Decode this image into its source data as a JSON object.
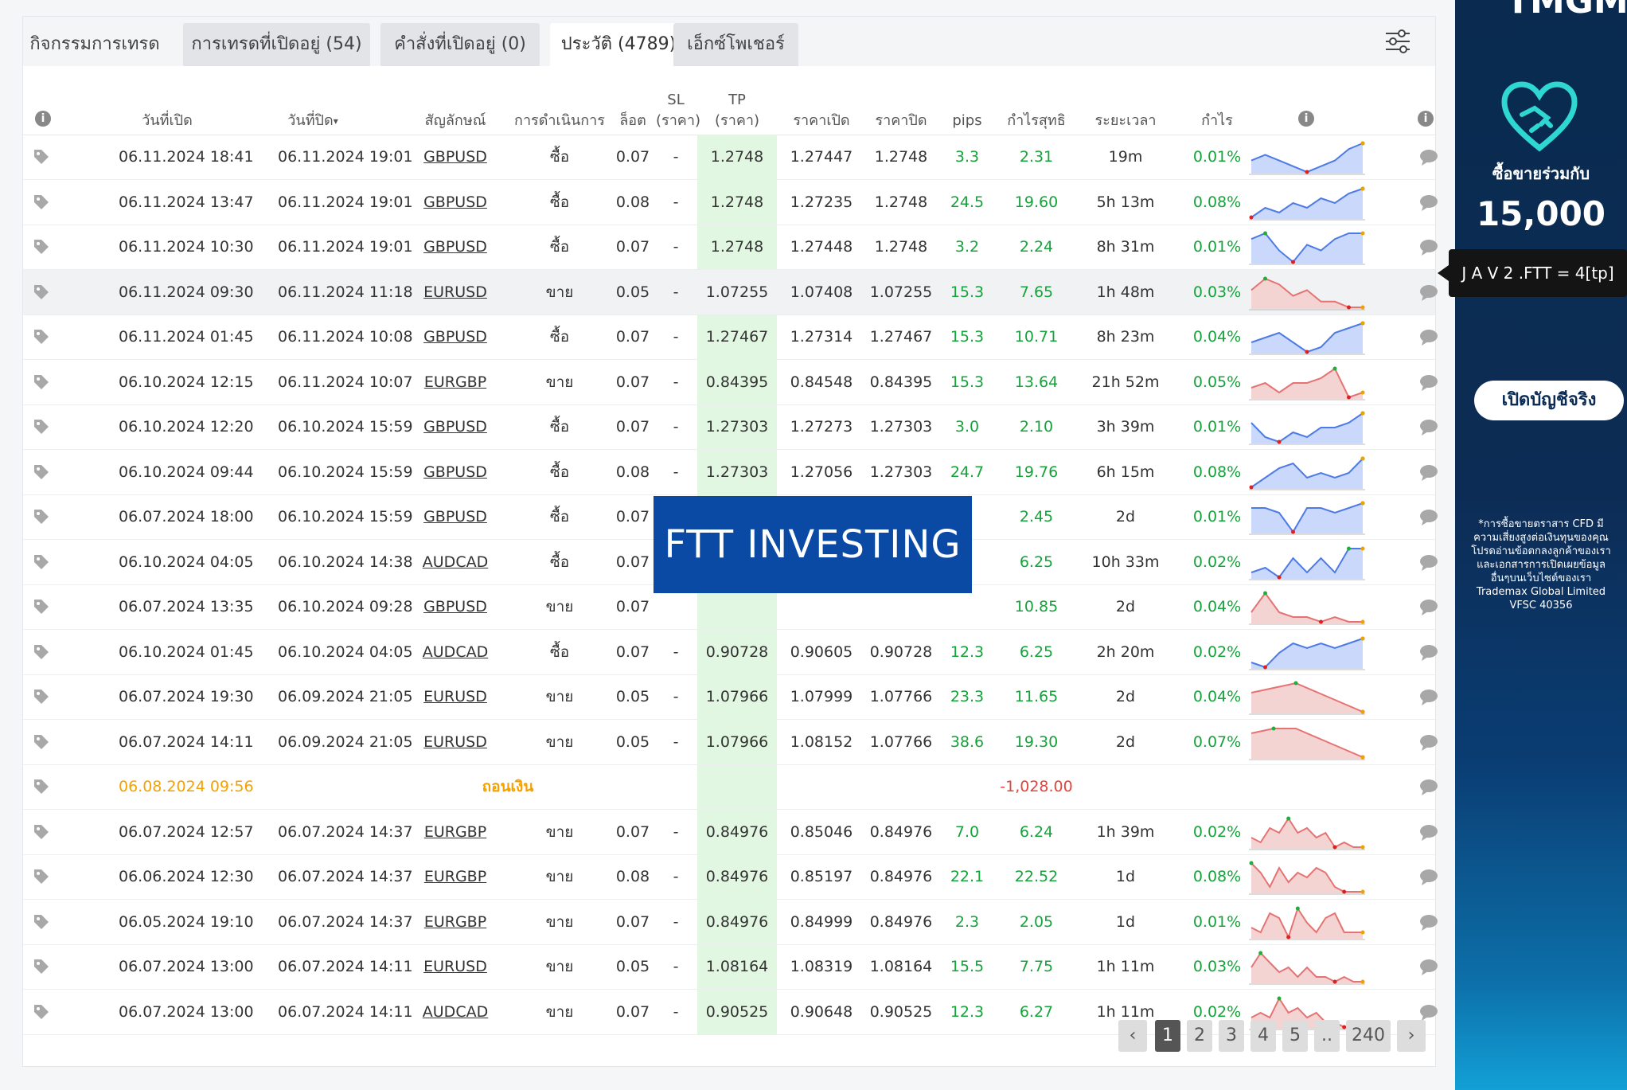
{
  "tabs": [
    {
      "label": "กิจกรรมการเทรด"
    },
    {
      "label": "การเทรดที่เปิดอยู่ (54)"
    },
    {
      "label": "คำสั่งที่เปิดอยู่ (0)"
    },
    {
      "label": "ประวัติ (4789)"
    },
    {
      "label": "เอ็กซ์โพเชอร์"
    }
  ],
  "active_tab": 3,
  "headers": {
    "open_time": "วันที่เปิด",
    "close_time": "วันที่ปิด",
    "sort_arrow": "▾",
    "symbol": "สัญลักษณ์",
    "action": "การดำเนินการ",
    "lots": "ล็อต",
    "sl_line1": "SL",
    "sl_line2": "(ราคา)",
    "tp_line1": "TP",
    "tp_line2": "(ราคา)",
    "open_price": "ราคาเปิด",
    "close_price": "ราคาปิด",
    "pips": "pips",
    "net_profit": "กำไรสุทธิ",
    "duration": "ระยะเวลา",
    "gain": "กำไร"
  },
  "rows": [
    {
      "open": "06.11.2024 18:41",
      "close": "06.11.2024 19:01",
      "symbol": "GBPUSD",
      "action": "ซื้อ",
      "lots": "0.07",
      "sl": "-",
      "tp": "1.2748",
      "open_price": "1.27447",
      "close_price": "1.2748",
      "pips": "3.3",
      "profit": "2.31",
      "duration": "19m",
      "gain": "0.01%",
      "spark": "buy",
      "spark_values": [
        3,
        4,
        3,
        2,
        1,
        2,
        3,
        5,
        6
      ]
    },
    {
      "open": "06.11.2024 13:47",
      "close": "06.11.2024 19:01",
      "symbol": "GBPUSD",
      "action": "ซื้อ",
      "lots": "0.08",
      "sl": "-",
      "tp": "1.2748",
      "open_price": "1.27235",
      "close_price": "1.2748",
      "pips": "24.5",
      "profit": "19.60",
      "duration": "5h 13m",
      "gain": "0.08%",
      "spark": "buy",
      "spark_values": [
        1,
        3,
        2,
        4,
        3,
        5,
        4,
        6,
        7
      ]
    },
    {
      "open": "06.11.2024 10:30",
      "close": "06.11.2024 19:01",
      "symbol": "GBPUSD",
      "action": "ซื้อ",
      "lots": "0.07",
      "sl": "-",
      "tp": "1.2748",
      "open_price": "1.27448",
      "close_price": "1.2748",
      "pips": "3.2",
      "profit": "2.24",
      "duration": "8h 31m",
      "gain": "0.01%",
      "spark": "buy",
      "spark_values": [
        5,
        6,
        3,
        1,
        4,
        3,
        5,
        6,
        6
      ]
    },
    {
      "open": "06.11.2024 09:30",
      "close": "06.11.2024 11:18",
      "symbol": "EURUSD",
      "action": "ขาย",
      "lots": "0.05",
      "sl": "-",
      "tp": "1.07255",
      "open_price": "1.07408",
      "close_price": "1.07255",
      "pips": "15.3",
      "profit": "7.65",
      "duration": "1h 48m",
      "gain": "0.03%",
      "spark": "sell",
      "spark_values": [
        4,
        6,
        5,
        3,
        4,
        2,
        2,
        1,
        1
      ],
      "highlight": true
    },
    {
      "open": "06.11.2024 01:45",
      "close": "06.11.2024 10:08",
      "symbol": "GBPUSD",
      "action": "ซื้อ",
      "lots": "0.07",
      "sl": "-",
      "tp": "1.27467",
      "open_price": "1.27314",
      "close_price": "1.27467",
      "pips": "15.3",
      "profit": "10.71",
      "duration": "8h 23m",
      "gain": "0.04%",
      "spark": "buy",
      "spark_values": [
        3,
        4,
        5,
        3,
        1,
        2,
        5,
        6,
        7
      ]
    },
    {
      "open": "06.10.2024 12:15",
      "close": "06.11.2024 10:07",
      "symbol": "EURGBP",
      "action": "ขาย",
      "lots": "0.07",
      "sl": "-",
      "tp": "0.84395",
      "open_price": "0.84548",
      "close_price": "0.84395",
      "pips": "15.3",
      "profit": "13.64",
      "duration": "21h 52m",
      "gain": "0.05%",
      "spark": "sell",
      "spark_values": [
        3,
        4,
        2,
        4,
        4,
        5,
        7,
        1,
        2
      ]
    },
    {
      "open": "06.10.2024 12:20",
      "close": "06.10.2024 15:59",
      "symbol": "GBPUSD",
      "action": "ซื้อ",
      "lots": "0.07",
      "sl": "-",
      "tp": "1.27303",
      "open_price": "1.27273",
      "close_price": "1.27303",
      "pips": "3.0",
      "profit": "2.10",
      "duration": "3h 39m",
      "gain": "0.01%",
      "spark": "buy",
      "spark_values": [
        5,
        2,
        1,
        3,
        2,
        4,
        4,
        5,
        7
      ]
    },
    {
      "open": "06.10.2024 09:44",
      "close": "06.10.2024 15:59",
      "symbol": "GBPUSD",
      "action": "ซื้อ",
      "lots": "0.08",
      "sl": "-",
      "tp": "1.27303",
      "open_price": "1.27056",
      "close_price": "1.27303",
      "pips": "24.7",
      "profit": "19.76",
      "duration": "6h 15m",
      "gain": "0.08%",
      "spark": "buy",
      "spark_values": [
        1,
        3,
        5,
        6,
        3,
        4,
        3,
        4,
        7
      ]
    },
    {
      "open": "06.07.2024 18:00",
      "close": "06.10.2024 15:59",
      "symbol": "GBPUSD",
      "action": "ซื้อ",
      "lots": "0.07",
      "sl": "",
      "tp": "",
      "open_price": "",
      "close_price": "",
      "pips": "",
      "profit": "2.45",
      "duration": "2d",
      "gain": "0.01%",
      "spark": "buy",
      "spark_values": [
        6,
        6,
        5,
        1,
        6,
        6,
        5,
        6,
        7
      ]
    },
    {
      "open": "06.10.2024 04:05",
      "close": "06.10.2024 14:38",
      "symbol": "AUDCAD",
      "action": "ซื้อ",
      "lots": "0.07",
      "sl": "",
      "tp": "",
      "open_price": "",
      "close_price": "",
      "pips": "",
      "profit": "6.25",
      "duration": "10h 33m",
      "gain": "0.02%",
      "spark": "buy",
      "spark_values": [
        2,
        3,
        1,
        5,
        2,
        5,
        2,
        7,
        7
      ]
    },
    {
      "open": "06.07.2024 13:35",
      "close": "06.10.2024 09:28",
      "symbol": "GBPUSD",
      "action": "ขาย",
      "lots": "0.07",
      "sl": "",
      "tp": "",
      "open_price": "",
      "close_price": "",
      "pips": "",
      "profit": "10.85",
      "duration": "2d",
      "gain": "0.04%",
      "spark": "sell",
      "spark_values": [
        3,
        7,
        3,
        2,
        2,
        1,
        2,
        1,
        1
      ]
    },
    {
      "open": "06.10.2024 01:45",
      "close": "06.10.2024 04:05",
      "symbol": "AUDCAD",
      "action": "ซื้อ",
      "lots": "0.07",
      "sl": "-",
      "tp": "0.90728",
      "open_price": "0.90605",
      "close_price": "0.90728",
      "pips": "12.3",
      "profit": "6.25",
      "duration": "2h 20m",
      "gain": "0.02%",
      "spark": "buy",
      "spark_values": [
        2,
        1,
        4,
        6,
        5,
        6,
        5,
        6,
        7
      ]
    },
    {
      "open": "06.07.2024 19:30",
      "close": "06.09.2024 21:05",
      "symbol": "EURUSD",
      "action": "ขาย",
      "lots": "0.05",
      "sl": "-",
      "tp": "1.07966",
      "open_price": "1.07999",
      "close_price": "1.07766",
      "pips": "23.3",
      "profit": "11.65",
      "duration": "2d",
      "gain": "0.04%",
      "spark": "sell",
      "spark_values": [
        6,
        7,
        8,
        6,
        4,
        2
      ]
    },
    {
      "open": "06.07.2024 14:11",
      "close": "06.09.2024 21:05",
      "symbol": "EURUSD",
      "action": "ขาย",
      "lots": "0.05",
      "sl": "-",
      "tp": "1.07966",
      "open_price": "1.08152",
      "close_price": "1.07766",
      "pips": "38.6",
      "profit": "19.30",
      "duration": "2d",
      "gain": "0.07%",
      "spark": "sell",
      "spark_values": [
        6,
        7,
        7,
        5,
        3,
        1
      ]
    },
    {
      "open": "06.08.2024 09:56",
      "close": "",
      "symbol": "",
      "action": "ถอนเงิน",
      "lots": "",
      "sl": "",
      "tp": "",
      "open_price": "",
      "close_price": "",
      "pips": "",
      "profit": "-1,028.00",
      "duration": "",
      "gain": "",
      "spark": "none",
      "withdrawal": true
    },
    {
      "open": "06.07.2024 12:57",
      "close": "06.07.2024 14:37",
      "symbol": "EURGBP",
      "action": "ขาย",
      "lots": "0.07",
      "sl": "-",
      "tp": "0.84976",
      "open_price": "0.85046",
      "close_price": "0.84976",
      "pips": "7.0",
      "profit": "6.24",
      "duration": "1h 39m",
      "gain": "0.02%",
      "spark": "sell",
      "spark_values": [
        3,
        2,
        5,
        4,
        7,
        4,
        5,
        3,
        4,
        1,
        2,
        1,
        1
      ]
    },
    {
      "open": "06.06.2024 12:30",
      "close": "06.07.2024 14:37",
      "symbol": "EURGBP",
      "action": "ขาย",
      "lots": "0.08",
      "sl": "-",
      "tp": "0.84976",
      "open_price": "0.85197",
      "close_price": "0.84976",
      "pips": "22.1",
      "profit": "22.52",
      "duration": "1d",
      "gain": "0.08%",
      "spark": "sell",
      "spark_values": [
        7,
        5,
        2,
        6,
        3,
        5,
        4,
        6,
        5,
        2,
        1,
        1,
        1
      ]
    },
    {
      "open": "06.05.2024 19:10",
      "close": "06.07.2024 14:37",
      "symbol": "EURGBP",
      "action": "ขาย",
      "lots": "0.07",
      "sl": "-",
      "tp": "0.84976",
      "open_price": "0.84999",
      "close_price": "0.84976",
      "pips": "2.3",
      "profit": "2.05",
      "duration": "1d",
      "gain": "0.01%",
      "spark": "sell",
      "spark_values": [
        3,
        2,
        6,
        5,
        1,
        7,
        4,
        2,
        5,
        6,
        2,
        2,
        2
      ]
    },
    {
      "open": "06.07.2024 13:00",
      "close": "06.07.2024 14:11",
      "symbol": "EURUSD",
      "action": "ขาย",
      "lots": "0.05",
      "sl": "-",
      "tp": "1.08164",
      "open_price": "1.08319",
      "close_price": "1.08164",
      "pips": "15.5",
      "profit": "7.75",
      "duration": "1h 11m",
      "gain": "0.03%",
      "spark": "sell",
      "spark_values": [
        4,
        7,
        5,
        3,
        4,
        2,
        4,
        2,
        2,
        1,
        2,
        1,
        1
      ]
    },
    {
      "open": "06.07.2024 13:00",
      "close": "06.07.2024 14:11",
      "symbol": "AUDCAD",
      "action": "ขาย",
      "lots": "0.07",
      "sl": "-",
      "tp": "0.90525",
      "open_price": "0.90648",
      "close_price": "0.90525",
      "pips": "12.3",
      "profit": "6.27",
      "duration": "1h 11m",
      "gain": "0.02%",
      "spark": "sell",
      "spark_values": [
        3,
        4,
        3,
        7,
        4,
        5,
        3,
        4,
        2,
        2,
        1,
        1,
        1
      ]
    }
  ],
  "pagination": {
    "prev": "‹",
    "pages": [
      "1",
      "2",
      "3",
      "4",
      "5"
    ],
    "ellipsis": "..",
    "last": "240",
    "next": "›",
    "current": "1"
  },
  "banner": "FTT INVESTING",
  "tooltip": "J A V 2 .FTT = 4[tp]",
  "ad": {
    "top_text": "TMGM",
    "headline": "ซื้อขายร่วมกับ",
    "number": "15,000",
    "button": "เปิดบัญชีจริง",
    "disclaimer": "*การซื้อขายตราสาร CFD มีความเสี่ยงสูงต่อเงินทุนของคุณ โปรดอ่านข้อตกลงลูกค้าของเรา และเอกสารการเปิดเผยข้อมูล อื่นๆบนเว็บไซต์ของเรา Trademax Global Limited VFSC 40356"
  },
  "colors": {
    "buy_line": "#4d7be6",
    "buy_fill": "#c9d8fb",
    "sell_line": "#e57373",
    "sell_fill": "#f4d3d3",
    "tp_col": "#e2f7e2",
    "profit": "#15a33b",
    "negative": "#e0453e",
    "withdraw": "#f5a200",
    "banner": "#0b4aa4"
  }
}
